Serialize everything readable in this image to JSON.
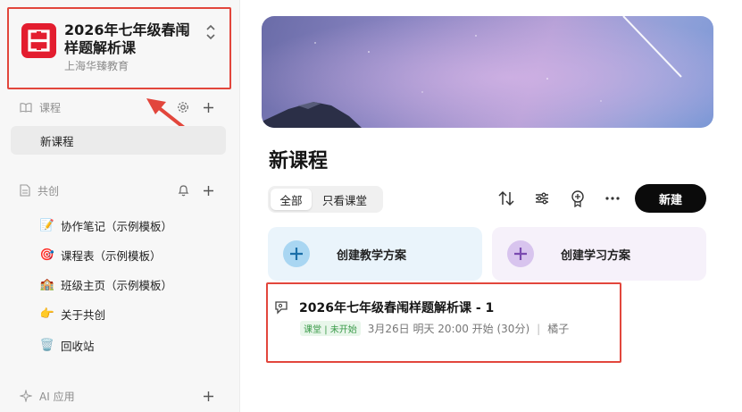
{
  "org": {
    "logo": "hz-brand-logo",
    "title": "2026年七年级春闱样题解析课",
    "subtitle": "上海华臻教育"
  },
  "sidebar": {
    "courses": {
      "label": "课程",
      "items": [
        {
          "label": "新课程",
          "active": true
        }
      ]
    },
    "cocreate": {
      "label": "共创",
      "items": [
        {
          "icon": "📝",
          "label": "协作笔记（示例模板）"
        },
        {
          "icon": "🎯",
          "label": "课程表（示例模板）"
        },
        {
          "icon": "🏫",
          "label": "班级主页（示例模板）"
        },
        {
          "icon": "👉",
          "label": "关于共创"
        },
        {
          "icon": "🗑️",
          "label": "回收站"
        }
      ]
    },
    "ai": {
      "label": "AI 应用"
    }
  },
  "main": {
    "title": "新课程",
    "filters": [
      "全部",
      "只看课堂"
    ],
    "new_label": "新建",
    "plans": [
      {
        "label": "创建教学方案"
      },
      {
        "label": "创建学习方案"
      }
    ],
    "course": {
      "title": "2026年七年级春闱样题解析课 - 1",
      "tag_type": "课堂",
      "tag_sep": "|",
      "tag_status": "未开始",
      "schedule": "3月26日 明天 20:00 开始 (30分)",
      "sep": "|",
      "teacher": "橘子"
    }
  },
  "colors": {
    "brand": "#e31d2f",
    "highlight": "#e2463c",
    "primary_button": "#0b0b0b",
    "tag_green": "#3b9b4a"
  }
}
